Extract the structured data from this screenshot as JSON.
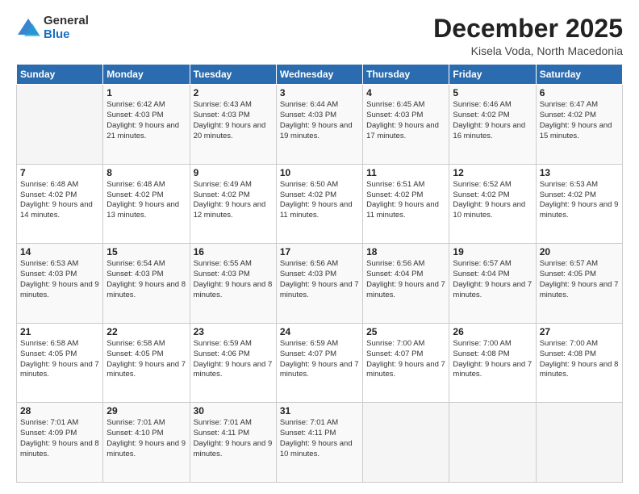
{
  "logo": {
    "general": "General",
    "blue": "Blue"
  },
  "header": {
    "month": "December 2025",
    "location": "Kisela Voda, North Macedonia"
  },
  "weekdays": [
    "Sunday",
    "Monday",
    "Tuesday",
    "Wednesday",
    "Thursday",
    "Friday",
    "Saturday"
  ],
  "weeks": [
    [
      {
        "day": "",
        "sunrise": "",
        "sunset": "",
        "daylight": ""
      },
      {
        "day": "1",
        "sunrise": "Sunrise: 6:42 AM",
        "sunset": "Sunset: 4:03 PM",
        "daylight": "Daylight: 9 hours and 21 minutes."
      },
      {
        "day": "2",
        "sunrise": "Sunrise: 6:43 AM",
        "sunset": "Sunset: 4:03 PM",
        "daylight": "Daylight: 9 hours and 20 minutes."
      },
      {
        "day": "3",
        "sunrise": "Sunrise: 6:44 AM",
        "sunset": "Sunset: 4:03 PM",
        "daylight": "Daylight: 9 hours and 19 minutes."
      },
      {
        "day": "4",
        "sunrise": "Sunrise: 6:45 AM",
        "sunset": "Sunset: 4:03 PM",
        "daylight": "Daylight: 9 hours and 17 minutes."
      },
      {
        "day": "5",
        "sunrise": "Sunrise: 6:46 AM",
        "sunset": "Sunset: 4:02 PM",
        "daylight": "Daylight: 9 hours and 16 minutes."
      },
      {
        "day": "6",
        "sunrise": "Sunrise: 6:47 AM",
        "sunset": "Sunset: 4:02 PM",
        "daylight": "Daylight: 9 hours and 15 minutes."
      }
    ],
    [
      {
        "day": "7",
        "sunrise": "Sunrise: 6:48 AM",
        "sunset": "Sunset: 4:02 PM",
        "daylight": "Daylight: 9 hours and 14 minutes."
      },
      {
        "day": "8",
        "sunrise": "Sunrise: 6:48 AM",
        "sunset": "Sunset: 4:02 PM",
        "daylight": "Daylight: 9 hours and 13 minutes."
      },
      {
        "day": "9",
        "sunrise": "Sunrise: 6:49 AM",
        "sunset": "Sunset: 4:02 PM",
        "daylight": "Daylight: 9 hours and 12 minutes."
      },
      {
        "day": "10",
        "sunrise": "Sunrise: 6:50 AM",
        "sunset": "Sunset: 4:02 PM",
        "daylight": "Daylight: 9 hours and 11 minutes."
      },
      {
        "day": "11",
        "sunrise": "Sunrise: 6:51 AM",
        "sunset": "Sunset: 4:02 PM",
        "daylight": "Daylight: 9 hours and 11 minutes."
      },
      {
        "day": "12",
        "sunrise": "Sunrise: 6:52 AM",
        "sunset": "Sunset: 4:02 PM",
        "daylight": "Daylight: 9 hours and 10 minutes."
      },
      {
        "day": "13",
        "sunrise": "Sunrise: 6:53 AM",
        "sunset": "Sunset: 4:02 PM",
        "daylight": "Daylight: 9 hours and 9 minutes."
      }
    ],
    [
      {
        "day": "14",
        "sunrise": "Sunrise: 6:53 AM",
        "sunset": "Sunset: 4:03 PM",
        "daylight": "Daylight: 9 hours and 9 minutes."
      },
      {
        "day": "15",
        "sunrise": "Sunrise: 6:54 AM",
        "sunset": "Sunset: 4:03 PM",
        "daylight": "Daylight: 9 hours and 8 minutes."
      },
      {
        "day": "16",
        "sunrise": "Sunrise: 6:55 AM",
        "sunset": "Sunset: 4:03 PM",
        "daylight": "Daylight: 9 hours and 8 minutes."
      },
      {
        "day": "17",
        "sunrise": "Sunrise: 6:56 AM",
        "sunset": "Sunset: 4:03 PM",
        "daylight": "Daylight: 9 hours and 7 minutes."
      },
      {
        "day": "18",
        "sunrise": "Sunrise: 6:56 AM",
        "sunset": "Sunset: 4:04 PM",
        "daylight": "Daylight: 9 hours and 7 minutes."
      },
      {
        "day": "19",
        "sunrise": "Sunrise: 6:57 AM",
        "sunset": "Sunset: 4:04 PM",
        "daylight": "Daylight: 9 hours and 7 minutes."
      },
      {
        "day": "20",
        "sunrise": "Sunrise: 6:57 AM",
        "sunset": "Sunset: 4:05 PM",
        "daylight": "Daylight: 9 hours and 7 minutes."
      }
    ],
    [
      {
        "day": "21",
        "sunrise": "Sunrise: 6:58 AM",
        "sunset": "Sunset: 4:05 PM",
        "daylight": "Daylight: 9 hours and 7 minutes."
      },
      {
        "day": "22",
        "sunrise": "Sunrise: 6:58 AM",
        "sunset": "Sunset: 4:05 PM",
        "daylight": "Daylight: 9 hours and 7 minutes."
      },
      {
        "day": "23",
        "sunrise": "Sunrise: 6:59 AM",
        "sunset": "Sunset: 4:06 PM",
        "daylight": "Daylight: 9 hours and 7 minutes."
      },
      {
        "day": "24",
        "sunrise": "Sunrise: 6:59 AM",
        "sunset": "Sunset: 4:07 PM",
        "daylight": "Daylight: 9 hours and 7 minutes."
      },
      {
        "day": "25",
        "sunrise": "Sunrise: 7:00 AM",
        "sunset": "Sunset: 4:07 PM",
        "daylight": "Daylight: 9 hours and 7 minutes."
      },
      {
        "day": "26",
        "sunrise": "Sunrise: 7:00 AM",
        "sunset": "Sunset: 4:08 PM",
        "daylight": "Daylight: 9 hours and 7 minutes."
      },
      {
        "day": "27",
        "sunrise": "Sunrise: 7:00 AM",
        "sunset": "Sunset: 4:08 PM",
        "daylight": "Daylight: 9 hours and 8 minutes."
      }
    ],
    [
      {
        "day": "28",
        "sunrise": "Sunrise: 7:01 AM",
        "sunset": "Sunset: 4:09 PM",
        "daylight": "Daylight: 9 hours and 8 minutes."
      },
      {
        "day": "29",
        "sunrise": "Sunrise: 7:01 AM",
        "sunset": "Sunset: 4:10 PM",
        "daylight": "Daylight: 9 hours and 9 minutes."
      },
      {
        "day": "30",
        "sunrise": "Sunrise: 7:01 AM",
        "sunset": "Sunset: 4:11 PM",
        "daylight": "Daylight: 9 hours and 9 minutes."
      },
      {
        "day": "31",
        "sunrise": "Sunrise: 7:01 AM",
        "sunset": "Sunset: 4:11 PM",
        "daylight": "Daylight: 9 hours and 10 minutes."
      },
      {
        "day": "",
        "sunrise": "",
        "sunset": "",
        "daylight": ""
      },
      {
        "day": "",
        "sunrise": "",
        "sunset": "",
        "daylight": ""
      },
      {
        "day": "",
        "sunrise": "",
        "sunset": "",
        "daylight": ""
      }
    ]
  ]
}
